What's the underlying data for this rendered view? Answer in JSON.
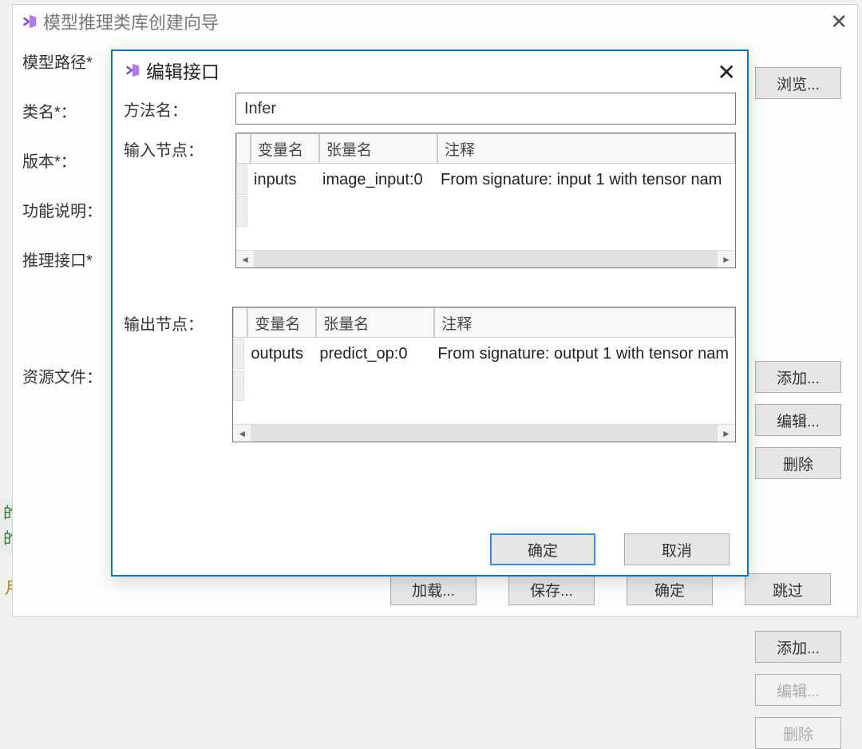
{
  "parent_window": {
    "title": "模型推理类库创建向导",
    "labels": {
      "model_path": "模型路径*",
      "class_name": "类名*：",
      "version": "版本*：",
      "function_desc": "功能说明：",
      "infer_interface": "推理接口*",
      "resource_files": "资源文件："
    },
    "buttons": {
      "browse": "浏览...",
      "add": "添加...",
      "edit": "编辑...",
      "delete": "删除",
      "load": "加载...",
      "save": "保存...",
      "ok": "确定",
      "skip": "跳过"
    }
  },
  "modal": {
    "title": "编辑接口",
    "labels": {
      "method_name": "方法名：",
      "input_nodes": "输入节点：",
      "output_nodes": "输出节点："
    },
    "method_value": "Infer",
    "table_headers": {
      "var_name": "变量名",
      "tensor_name": "张量名",
      "comment": "注释"
    },
    "input_rows": [
      {
        "var": "inputs",
        "tensor": "image_input:0",
        "comment": "From signature: input 1 with tensor nam"
      }
    ],
    "output_rows": [
      {
        "var": "outputs",
        "tensor": "predict_op:0",
        "comment": "From signature: output 1 with tensor nam"
      }
    ],
    "buttons": {
      "ok": "确定",
      "cancel": "取消"
    }
  },
  "fragments": {
    "green1": "的",
    "green2": "的",
    "gold": "月"
  }
}
